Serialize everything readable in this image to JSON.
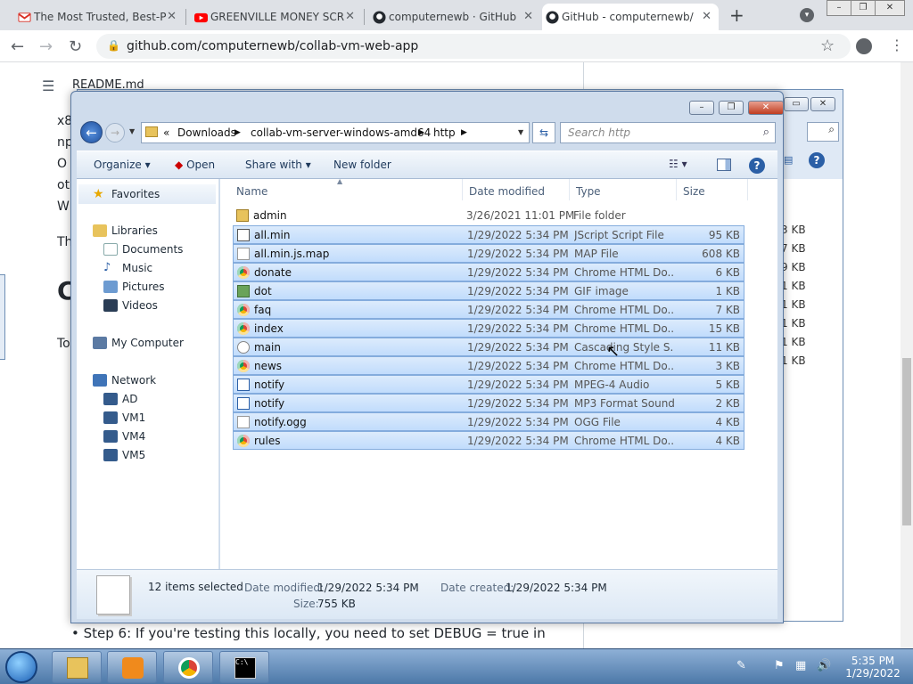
{
  "browser": {
    "tabs": [
      {
        "title": "The Most Trusted, Best-P"
      },
      {
        "title": "GREENVILLE MONEY SCR"
      },
      {
        "title": "computernewb · GitHub"
      },
      {
        "title": "GitHub - computernewb/"
      }
    ],
    "url": "github.com/computernewb/collab-vm-web-app"
  },
  "github": {
    "readme_label": "README.md",
    "fragments": [
      "x8",
      "np",
      "O",
      "ot",
      "W",
      "Th",
      "C",
      "To"
    ],
    "step6": "Step 6: If you're testing this locally, you need to set DEBUG = true in"
  },
  "behind_window": {
    "sizes": [
      "3 KB",
      "7 KB",
      "9 KB",
      "1 KB",
      "1 KB",
      "1 KB",
      "1 KB",
      "1 KB"
    ]
  },
  "explorer": {
    "breadcrumb": [
      "«",
      "Downloads",
      "collab-vm-server-windows-amd64",
      "http"
    ],
    "search_placeholder": "Search http",
    "commands": {
      "organize": "Organize",
      "open": "Open",
      "share_with": "Share with",
      "new_folder": "New folder"
    },
    "nav": {
      "favorites": "Favorites",
      "libraries": "Libraries",
      "documents": "Documents",
      "music": "Music",
      "pictures": "Pictures",
      "videos": "Videos",
      "computer": "My Computer",
      "network": "Network",
      "ad": "AD",
      "vm1": "VM1",
      "vm4": "VM4",
      "vm5": "VM5"
    },
    "columns": {
      "name": "Name",
      "date": "Date modified",
      "type": "Type",
      "size": "Size"
    },
    "files": [
      {
        "name": "admin",
        "date": "3/26/2021 11:01 PM",
        "type": "File folder",
        "size": "",
        "icon": "folder-icon",
        "selected": false
      },
      {
        "name": "all.min",
        "date": "1/29/2022 5:34 PM",
        "type": "JScript Script File",
        "size": "95 KB",
        "icon": "script-icon",
        "selected": true
      },
      {
        "name": "all.min.js.map",
        "date": "1/29/2022 5:34 PM",
        "type": "MAP File",
        "size": "608 KB",
        "icon": "file-icon",
        "selected": true
      },
      {
        "name": "donate",
        "date": "1/29/2022 5:34 PM",
        "type": "Chrome HTML Do...",
        "size": "6 KB",
        "icon": "chrome-icon",
        "selected": true
      },
      {
        "name": "dot",
        "date": "1/29/2022 5:34 PM",
        "type": "GIF image",
        "size": "1 KB",
        "icon": "image-icon",
        "selected": true
      },
      {
        "name": "faq",
        "date": "1/29/2022 5:34 PM",
        "type": "Chrome HTML Do...",
        "size": "7 KB",
        "icon": "chrome-icon",
        "selected": true
      },
      {
        "name": "index",
        "date": "1/29/2022 5:34 PM",
        "type": "Chrome HTML Do...",
        "size": "15 KB",
        "icon": "chrome-icon",
        "selected": true
      },
      {
        "name": "main",
        "date": "1/29/2022 5:34 PM",
        "type": "Cascading Style S...",
        "size": "11 KB",
        "icon": "css-icon",
        "selected": true
      },
      {
        "name": "news",
        "date": "1/29/2022 5:34 PM",
        "type": "Chrome HTML Do...",
        "size": "3 KB",
        "icon": "chrome-icon",
        "selected": true
      },
      {
        "name": "notify",
        "date": "1/29/2022 5:34 PM",
        "type": "MPEG-4 Audio",
        "size": "5 KB",
        "icon": "audio-icon",
        "selected": true
      },
      {
        "name": "notify",
        "date": "1/29/2022 5:34 PM",
        "type": "MP3 Format Sound",
        "size": "2 KB",
        "icon": "audio-icon",
        "selected": true
      },
      {
        "name": "notify.ogg",
        "date": "1/29/2022 5:34 PM",
        "type": "OGG File",
        "size": "4 KB",
        "icon": "file-icon",
        "selected": true
      },
      {
        "name": "rules",
        "date": "1/29/2022 5:34 PM",
        "type": "Chrome HTML Do...",
        "size": "4 KB",
        "icon": "chrome-icon",
        "selected": true
      }
    ],
    "details": {
      "selected": "12 items selected",
      "date_modified_label": "Date modified:",
      "date_modified": "1/29/2022 5:34 PM",
      "date_created_label": "Date created:",
      "date_created": "1/29/2022 5:34 PM",
      "size_label": "Size:",
      "size": "755 KB"
    }
  },
  "taskbar": {
    "time": "5:35 PM",
    "date": "1/29/2022"
  },
  "colors": {
    "selection": "#cce1fb",
    "selection_border": "#84acdd",
    "accent": "#2b5fa6"
  }
}
